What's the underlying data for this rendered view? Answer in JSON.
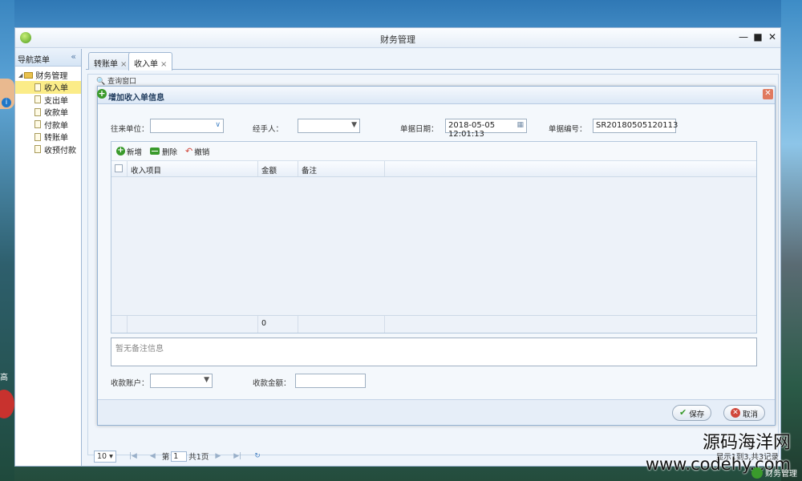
{
  "window": {
    "title": "财务管理"
  },
  "nav": {
    "header": "导航菜单",
    "collapse_glyph": "«",
    "root": "财务管理",
    "items": [
      {
        "label": "收入单",
        "selected": true
      },
      {
        "label": "支出单"
      },
      {
        "label": "收款单"
      },
      {
        "label": "付款单"
      },
      {
        "label": "转账单"
      },
      {
        "label": "收预付款"
      }
    ]
  },
  "tabs": [
    {
      "label": "转账单"
    },
    {
      "label": "收入单",
      "active": true
    }
  ],
  "query_window": {
    "title": "查询窗口"
  },
  "pager": {
    "page_size": "10",
    "page_label": "第",
    "page_value": "1",
    "total_label": "共1页",
    "info": "显示1到3,共3记录"
  },
  "dialog": {
    "title": "增加收入单信息",
    "fields": {
      "partner_label": "往来单位：",
      "handler_label": "经手人：",
      "date_label": "单据日期：",
      "date_value": "2018-05-05 12:01:13",
      "number_label": "单据编号：",
      "number_value": "SR20180505120113",
      "account_label": "收款账户：",
      "amount_label": "收款金额："
    },
    "toolbar": {
      "add": "新增",
      "delete": "删除",
      "undo": "撤销"
    },
    "grid": {
      "columns": [
        "收入项目",
        "金额",
        "备注"
      ],
      "footer_total": "0"
    },
    "remark_placeholder": "暂无备注信息",
    "buttons": {
      "save": "保存",
      "cancel": "取消"
    }
  },
  "watermark": {
    "line1": "源码海洋网",
    "line2": "www.codehy.com"
  },
  "taskbar": {
    "label": "财务管理"
  },
  "side_text": "高"
}
